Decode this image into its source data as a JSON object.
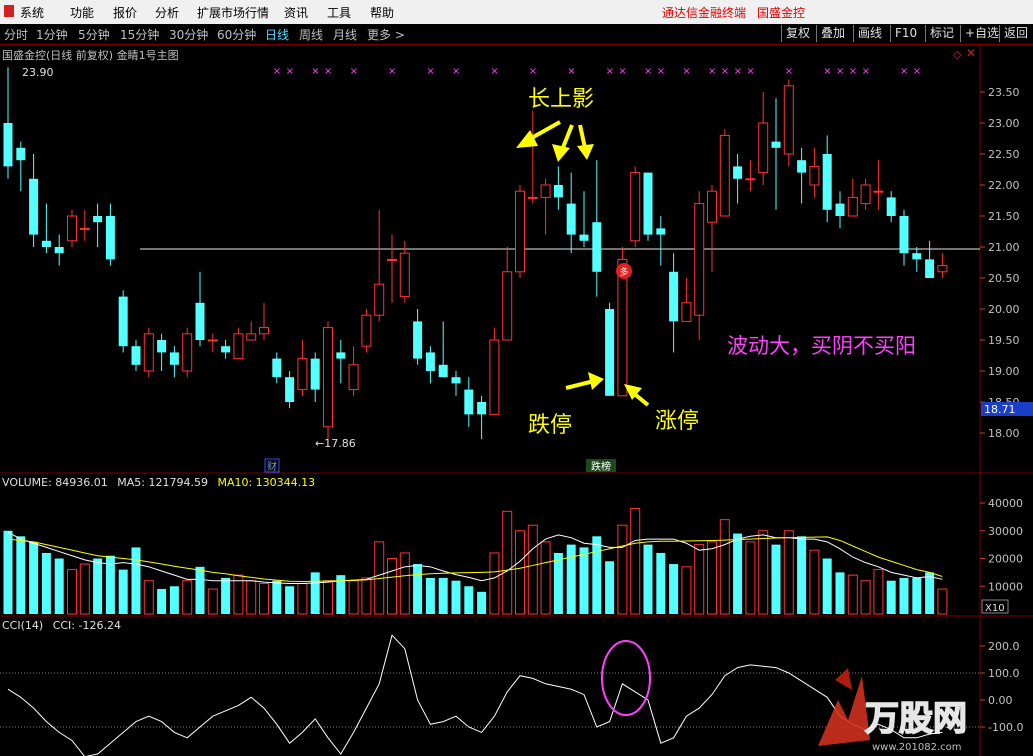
{
  "menu": {
    "items": [
      "系统",
      "功能",
      "报价",
      "分析",
      "扩展市场行情",
      "资讯",
      "工具",
      "帮助"
    ],
    "brand_left": "通达信金融终端",
    "brand_right": "国盛金控"
  },
  "toolbar": {
    "periods": [
      "分时",
      "1分钟",
      "5分钟",
      "15分钟",
      "30分钟",
      "60分钟",
      "日线",
      "周线",
      "月线",
      "更多 >"
    ],
    "active_period": "日线",
    "buttons": [
      "复权",
      "叠加",
      "画线",
      "F10",
      "标记",
      "+自选",
      "返回"
    ]
  },
  "main_panel": {
    "title": "国盛金控(日线 前复权) 金睛1号主图",
    "high_label": "23.90",
    "low_label": "←17.86",
    "current_price": "18.71",
    "price_axis": [
      "23.50",
      "23.00",
      "22.50",
      "22.00",
      "21.50",
      "21.00",
      "20.50",
      "20.00",
      "19.50",
      "19.00",
      "18.50",
      "18.00"
    ],
    "annotations": {
      "long_upper_shadow": "长上影",
      "limit_down": "跌停",
      "limit_up": "涨停",
      "comment": "波动大，买阴不买阳"
    },
    "badges": {
      "duo": "多",
      "cai": "财",
      "dieb": "跌榜"
    }
  },
  "volume_panel": {
    "label_volume": "VOLUME: 84936.01",
    "label_ma5": "MA5: 121794.59",
    "label_ma10": "MA10: 130344.13",
    "axis": [
      "40000",
      "30000",
      "20000",
      "10000"
    ],
    "multiplier": "X10"
  },
  "cci_panel": {
    "label": "CCI(14)",
    "value_label": "CCI: -126.24",
    "axis": [
      "200.0",
      "100.0",
      "0.00",
      "-100.0"
    ]
  },
  "watermark": {
    "text": "万股网",
    "url": "www.201082.com"
  },
  "colors": {
    "up": "#ff3232",
    "down": "#54ffff",
    "ma10": "#ffff00",
    "ma5": "#ffffff",
    "annotation": "#ffff00",
    "comment": "#ff40ff"
  },
  "chart_data": [
    {
      "type": "candlestick",
      "title": "国盛金控(日线 前复权) 金睛1号主图",
      "ylim": [
        17.8,
        23.9
      ],
      "candles": [
        [
          23.0,
          22.3,
          23.9,
          22.1
        ],
        [
          22.6,
          22.4,
          22.7,
          21.9
        ],
        [
          22.1,
          21.2,
          22.5,
          21.0
        ],
        [
          21.1,
          21.0,
          21.7,
          20.9
        ],
        [
          21.0,
          20.9,
          21.2,
          20.7
        ],
        [
          21.1,
          21.5,
          21.6,
          21.0
        ],
        [
          21.3,
          21.3,
          21.6,
          21.1
        ],
        [
          21.5,
          21.4,
          21.7,
          21.0
        ],
        [
          21.5,
          20.8,
          21.7,
          20.7
        ],
        [
          20.2,
          19.4,
          20.3,
          19.3
        ],
        [
          19.4,
          19.1,
          19.5,
          19.0
        ],
        [
          19.0,
          19.6,
          19.7,
          18.9
        ],
        [
          19.5,
          19.3,
          19.6,
          19.0
        ],
        [
          19.3,
          19.1,
          19.4,
          18.9
        ],
        [
          19.0,
          19.6,
          19.7,
          18.9
        ],
        [
          20.1,
          19.5,
          20.6,
          19.4
        ],
        [
          19.5,
          19.5,
          19.6,
          19.3
        ],
        [
          19.4,
          19.3,
          19.5,
          19.2
        ],
        [
          19.2,
          19.6,
          19.7,
          19.2
        ],
        [
          19.5,
          19.6,
          19.8,
          19.5
        ],
        [
          19.6,
          19.7,
          20.1,
          19.5
        ],
        [
          19.2,
          18.9,
          19.3,
          18.8
        ],
        [
          18.9,
          18.5,
          19.0,
          18.4
        ],
        [
          18.7,
          19.2,
          19.5,
          18.6
        ],
        [
          19.2,
          18.7,
          19.3,
          18.5
        ],
        [
          18.1,
          19.7,
          19.8,
          17.86
        ],
        [
          19.3,
          19.2,
          19.5,
          18.8
        ],
        [
          18.7,
          19.1,
          19.4,
          18.6
        ],
        [
          19.4,
          19.9,
          20.0,
          19.3
        ],
        [
          19.9,
          20.4,
          21.6,
          19.8
        ],
        [
          20.8,
          20.8,
          21.2,
          20.1
        ],
        [
          20.2,
          20.9,
          21.1,
          20.1
        ],
        [
          19.8,
          19.2,
          20.0,
          19.1
        ],
        [
          19.3,
          19.0,
          19.4,
          18.8
        ],
        [
          19.1,
          18.9,
          19.8,
          18.9
        ],
        [
          18.9,
          18.8,
          19.0,
          18.6
        ],
        [
          18.7,
          18.3,
          18.9,
          18.1
        ],
        [
          18.5,
          18.3,
          18.6,
          17.9
        ],
        [
          18.3,
          19.5,
          19.7,
          18.3
        ],
        [
          19.5,
          20.6,
          21.0,
          19.5
        ],
        [
          20.6,
          21.9,
          22.0,
          20.5
        ],
        [
          21.8,
          21.8,
          23.2,
          21.7
        ],
        [
          21.8,
          22.0,
          22.1,
          21.2
        ],
        [
          22.0,
          21.8,
          22.3,
          21.6
        ],
        [
          21.7,
          21.2,
          22.2,
          20.9
        ],
        [
          21.2,
          21.1,
          21.9,
          21.0
        ],
        [
          21.4,
          20.6,
          22.4,
          20.2
        ],
        [
          20.0,
          18.6,
          20.1,
          18.6
        ],
        [
          18.6,
          20.8,
          21.0,
          18.6
        ],
        [
          21.1,
          22.2,
          22.3,
          21.0
        ],
        [
          22.2,
          21.2,
          22.2,
          21.1
        ],
        [
          21.3,
          21.2,
          21.5,
          20.7
        ],
        [
          20.6,
          19.8,
          20.9,
          19.3
        ],
        [
          19.8,
          20.1,
          20.5,
          19.8
        ],
        [
          19.9,
          21.7,
          21.9,
          19.5
        ],
        [
          21.4,
          21.9,
          22.0,
          20.6
        ],
        [
          21.5,
          22.8,
          22.9,
          21.5
        ],
        [
          22.3,
          22.1,
          22.5,
          21.7
        ],
        [
          22.1,
          22.1,
          22.4,
          21.9
        ],
        [
          22.2,
          23.0,
          23.5,
          22.0
        ],
        [
          22.7,
          22.6,
          23.4,
          21.6
        ],
        [
          22.5,
          23.6,
          23.7,
          22.3
        ],
        [
          22.4,
          22.2,
          22.6,
          21.7
        ],
        [
          22.0,
          22.3,
          22.6,
          21.8
        ],
        [
          22.5,
          21.6,
          22.8,
          21.4
        ],
        [
          21.7,
          21.5,
          21.9,
          21.3
        ],
        [
          21.5,
          21.8,
          22.1,
          21.5
        ],
        [
          21.7,
          22.0,
          22.1,
          21.6
        ],
        [
          21.9,
          21.9,
          22.4,
          21.6
        ],
        [
          21.8,
          21.5,
          21.9,
          21.4
        ],
        [
          21.5,
          20.9,
          21.6,
          20.7
        ],
        [
          20.9,
          20.8,
          21.0,
          20.6
        ],
        [
          20.8,
          20.5,
          21.1,
          20.5
        ],
        [
          20.6,
          20.7,
          20.9,
          20.5
        ]
      ]
    },
    {
      "type": "bar",
      "title": "VOLUME",
      "ylim": [
        0,
        45000
      ],
      "values": [
        30000,
        28000,
        26000,
        22000,
        20000,
        16000,
        18000,
        20000,
        21000,
        16000,
        24000,
        12000,
        9000,
        10000,
        12000,
        17000,
        9000,
        13000,
        14000,
        12000,
        11000,
        12000,
        10000,
        11000,
        15000,
        12000,
        14000,
        12000,
        13000,
        26000,
        20000,
        22000,
        18000,
        13000,
        13000,
        12000,
        10000,
        8000,
        22000,
        37000,
        30000,
        32000,
        26000,
        22000,
        25000,
        24000,
        28000,
        19000,
        32000,
        38000,
        25000,
        22000,
        18000,
        17000,
        25000,
        26000,
        34000,
        29000,
        26000,
        30000,
        25000,
        30000,
        28000,
        23000,
        20000,
        15000,
        14000,
        12000,
        16000,
        12000,
        13000,
        13000,
        15000,
        9000
      ],
      "ma5": [
        29500,
        27000,
        25500,
        24000,
        22500,
        21000,
        19500,
        18500,
        18000,
        18500,
        18000,
        17000,
        15500,
        14000,
        12500,
        12500,
        12000,
        12000,
        12000,
        12000,
        11500,
        11200,
        11000,
        11000,
        11200,
        11500,
        12000,
        12200,
        12500,
        14000,
        15500,
        17000,
        17500,
        17000,
        15500,
        14200,
        13200,
        12000,
        13000,
        15500,
        19000,
        23500,
        27000,
        28500,
        27500,
        25500,
        25000,
        24000,
        24000,
        26500,
        27000,
        27000,
        27000,
        25500,
        23000,
        23500,
        25000,
        27000,
        28000,
        28500,
        27500,
        27500,
        27000,
        27000,
        26000,
        23500,
        20500,
        18500,
        17000,
        15000,
        14000,
        13000,
        13500,
        12500
      ],
      "ma10": [
        27000,
        26500,
        26000,
        25000,
        24000,
        23000,
        22000,
        21000,
        20500,
        20000,
        19500,
        18800,
        18000,
        17200,
        16500,
        15800,
        15000,
        14500,
        13800,
        13200,
        12600,
        12200,
        11800,
        11700,
        11800,
        11900,
        12000,
        12100,
        12300,
        12800,
        13300,
        13800,
        14200,
        14500,
        14700,
        14800,
        14900,
        15000,
        15200,
        15800,
        16500,
        17500,
        18500,
        19500,
        20500,
        21500,
        22500,
        23500,
        24500,
        25500,
        26000,
        26200,
        26200,
        26300,
        26400,
        26500,
        26600,
        26800,
        27000,
        27200,
        27400,
        27500,
        27600,
        27700,
        27800,
        26500,
        24500,
        22500,
        20500,
        19000,
        17500,
        16000,
        15000,
        13500
      ],
      "x_multiplier": "X10"
    },
    {
      "type": "line",
      "title": "CCI(14)",
      "ylim": [
        -220,
        260
      ],
      "values": [
        40,
        10,
        -30,
        -80,
        -120,
        -150,
        -210,
        -200,
        -160,
        -120,
        -80,
        -60,
        -80,
        -120,
        -140,
        -100,
        -60,
        -40,
        -20,
        10,
        -30,
        -90,
        -160,
        -120,
        -70,
        -140,
        -200,
        -120,
        -30,
        60,
        240,
        190,
        0,
        -90,
        -80,
        -60,
        -100,
        -120,
        -60,
        30,
        90,
        80,
        60,
        50,
        40,
        20,
        -100,
        -80,
        60,
        30,
        0,
        -160,
        -140,
        -60,
        -30,
        20,
        90,
        120,
        130,
        125,
        120,
        100,
        70,
        40,
        10,
        -60,
        -90,
        -110,
        -90,
        -110,
        -140,
        -140,
        -126,
        -120
      ]
    }
  ]
}
